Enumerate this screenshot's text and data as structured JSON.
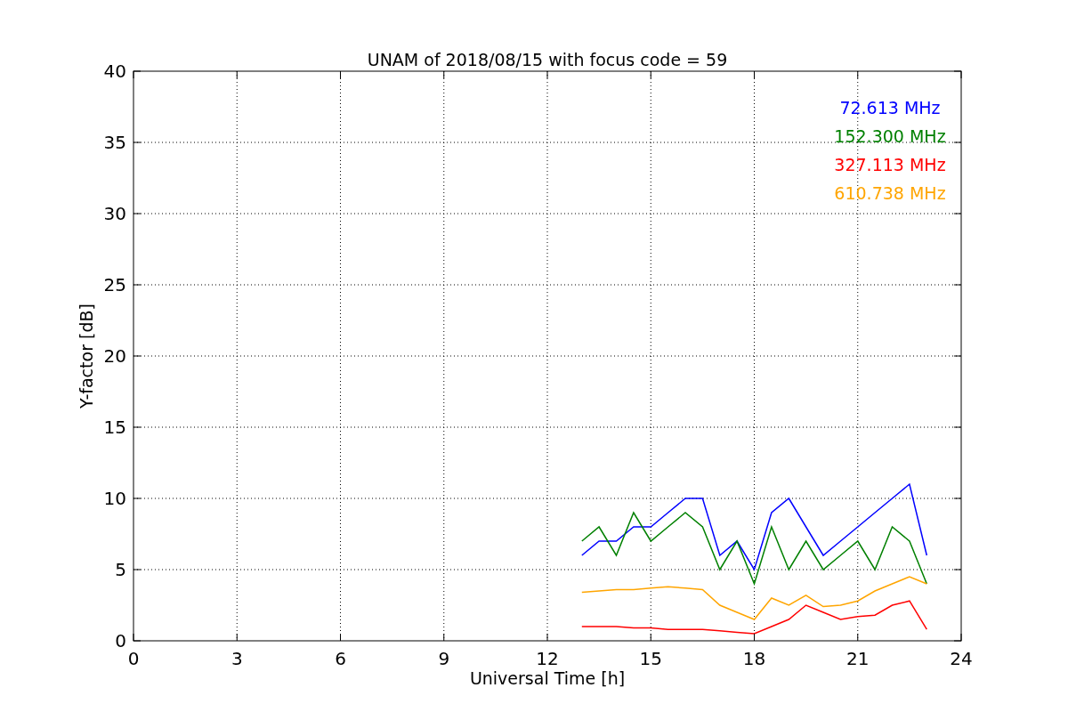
{
  "chart_data": {
    "type": "line",
    "title": "UNAM of 2018/08/15 with focus code = 59",
    "xlabel": "Universal Time [h]",
    "ylabel": "Y-factor [dB]",
    "x": [
      13,
      13.5,
      14,
      14.5,
      15,
      15.5,
      16,
      16.5,
      17,
      17.5,
      18,
      18.5,
      19,
      19.5,
      20,
      20.5,
      21,
      21.5,
      22,
      22.5,
      23
    ],
    "series": [
      {
        "name": "72.613 MHz",
        "color": "#0000ff",
        "values": [
          6,
          7,
          7,
          8,
          8,
          9,
          10,
          10,
          6,
          7,
          5,
          9,
          10,
          8,
          6,
          7,
          8,
          9,
          10,
          11,
          6
        ]
      },
      {
        "name": "152.300 MHz",
        "color": "#008000",
        "values": [
          7,
          8,
          6,
          9,
          7,
          8,
          9,
          8,
          5,
          7,
          4,
          8,
          5,
          7,
          5,
          6,
          7,
          5,
          8,
          7,
          4
        ]
      },
      {
        "name": "327.113 MHz",
        "color": "#ff0000",
        "values": [
          1,
          1,
          1,
          0.9,
          0.9,
          0.8,
          0.8,
          0.8,
          0.7,
          0.6,
          0.5,
          1,
          1.5,
          2.5,
          2,
          1.5,
          1.7,
          1.8,
          2.5,
          2.8,
          0.8
        ]
      },
      {
        "name": "610.738 MHz",
        "color": "#ffa500",
        "values": [
          3.4,
          3.5,
          3.6,
          3.6,
          3.7,
          3.8,
          3.7,
          3.6,
          2.5,
          2,
          1.5,
          3,
          2.5,
          3.2,
          2.4,
          2.5,
          2.8,
          3.5,
          4,
          4.5,
          4
        ]
      }
    ],
    "grid": true,
    "xlim": [
      0,
      24
    ],
    "ylim": [
      0,
      40
    ],
    "xticks": [
      0,
      3,
      6,
      9,
      12,
      15,
      18,
      21,
      24
    ],
    "yticks": [
      0,
      5,
      10,
      15,
      20,
      25,
      30,
      35,
      40
    ]
  }
}
